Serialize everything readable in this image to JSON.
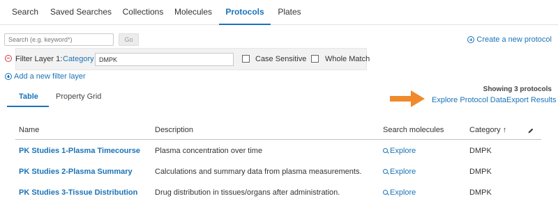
{
  "nav": {
    "tabs": [
      {
        "label": "Search"
      },
      {
        "label": "Saved Searches"
      },
      {
        "label": "Collections"
      },
      {
        "label": "Molecules"
      },
      {
        "label": "Protocols"
      },
      {
        "label": "Plates"
      }
    ],
    "active": "Protocols"
  },
  "search": {
    "placeholder": "Search (e.g. keyword*)",
    "value": "",
    "go_label": "Go"
  },
  "create_protocol_label": "Create a new protocol",
  "filter": {
    "layer_label": "Filter Layer 1:",
    "field_label": "Category",
    "value": "DMPK",
    "case_sensitive_label": "Case Sensitive",
    "whole_match_label": "Whole Match",
    "case_sensitive_checked": false,
    "whole_match_checked": false
  },
  "add_filter_label": "Add a new filter layer",
  "view_tabs": [
    {
      "label": "Table"
    },
    {
      "label": "Property Grid"
    }
  ],
  "summary": "Showing 3 protocols",
  "actions": {
    "explore_data": "Explore Protocol Data",
    "export": "Export Results"
  },
  "table": {
    "columns": [
      "Name",
      "Description",
      "Search molecules",
      "Category ↑"
    ],
    "rows": [
      {
        "name": "PK Studies 1-Plasma Timecourse",
        "description": "Plasma concentration over time",
        "explore": "Explore",
        "category": "DMPK"
      },
      {
        "name": "PK Studies 2-Plasma Summary",
        "description": "Calculations and summary data from plasma measurements.",
        "explore": "Explore",
        "category": "DMPK"
      },
      {
        "name": "PK Studies 3-Tissue Distribution",
        "description": "Drug distribution in tissues/organs after administration.",
        "explore": "Explore",
        "category": "DMPK"
      }
    ]
  },
  "colors": {
    "accent": "#1a73b8",
    "arrow": "#f08a2c",
    "remove": "#d9363e"
  }
}
